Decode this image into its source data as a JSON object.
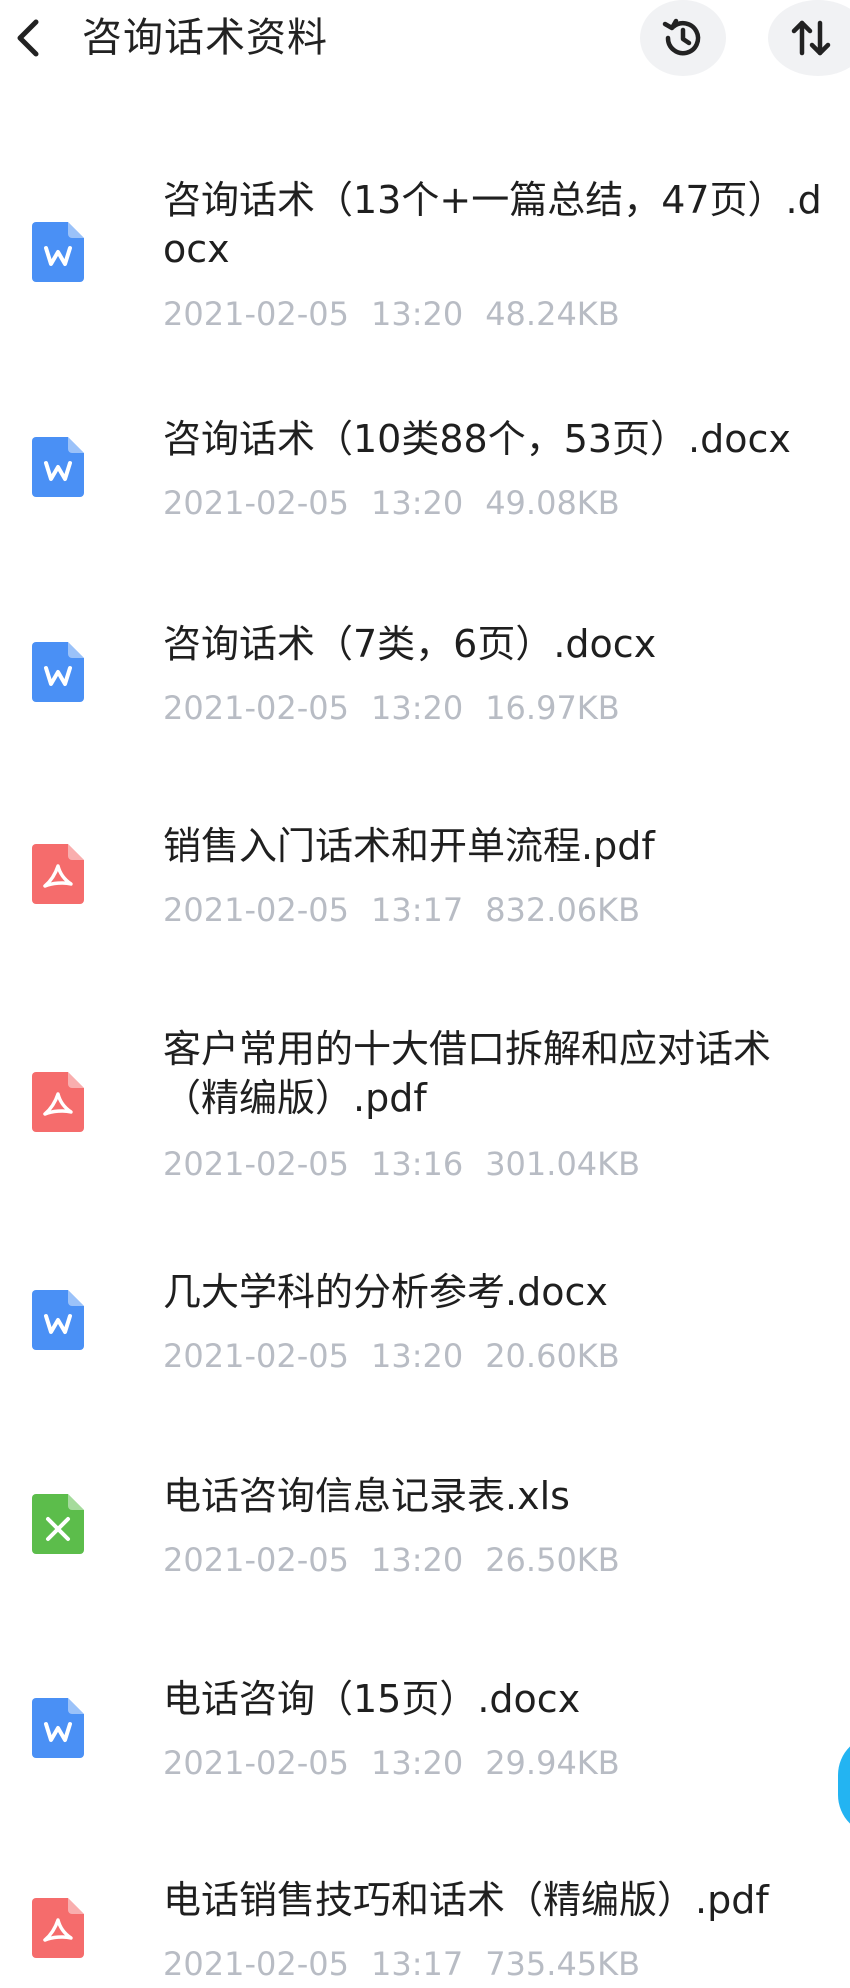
{
  "header": {
    "title": "咨询话术资料"
  },
  "colors": {
    "word": "#4a90f5",
    "pdf": "#f56c6c",
    "excel": "#5cbd4b",
    "meta_text": "#b8bcc4",
    "float_button": "#23b4f2"
  },
  "files": [
    {
      "name": "咨询话术（13个+一篇总结，47页）.docx",
      "date": "2021-02-05",
      "time": "13:20",
      "size": "48.24KB",
      "type": "word"
    },
    {
      "name": "咨询话术（10类88个，53页）.docx",
      "date": "2021-02-05",
      "time": "13:20",
      "size": "49.08KB",
      "type": "word"
    },
    {
      "name": "咨询话术（7类，6页）.docx",
      "date": "2021-02-05",
      "time": "13:20",
      "size": "16.97KB",
      "type": "word"
    },
    {
      "name": "销售入门话术和开单流程.pdf",
      "date": "2021-02-05",
      "time": "13:17",
      "size": "832.06KB",
      "type": "pdf"
    },
    {
      "name": "客户常用的十大借口拆解和应对话术（精编版）.pdf",
      "date": "2021-02-05",
      "time": "13:16",
      "size": "301.04KB",
      "type": "pdf"
    },
    {
      "name": "几大学科的分析参考.docx",
      "date": "2021-02-05",
      "time": "13:20",
      "size": "20.60KB",
      "type": "word"
    },
    {
      "name": "电话咨询信息记录表.xls",
      "date": "2021-02-05",
      "time": "13:20",
      "size": "26.50KB",
      "type": "excel"
    },
    {
      "name": "电话咨询（15页）.docx",
      "date": "2021-02-05",
      "time": "13:20",
      "size": "29.94KB",
      "type": "word"
    },
    {
      "name": "电话销售技巧和话术（精编版）.pdf",
      "date": "2021-02-05",
      "time": "13:17",
      "size": "735.45KB",
      "type": "pdf"
    }
  ]
}
